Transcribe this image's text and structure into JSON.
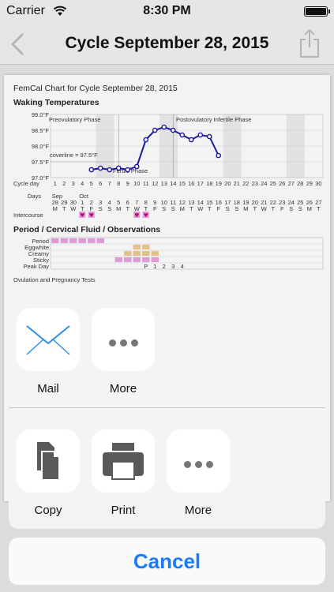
{
  "status_bar": {
    "carrier": "Carrier",
    "time": "8:30 PM"
  },
  "nav": {
    "title": "Cycle September 28, 2015"
  },
  "chart_document": {
    "heading": "FemCal Chart for Cycle September 28, 2015",
    "temp_section_title": "Waking Temperatures",
    "temp_axis_labels": [
      "99.0°F",
      "98.5°F",
      "98.0°F",
      "97.5°F",
      "97.0°F"
    ],
    "preovulatory_label": "Preovulatory Phase",
    "postovulatory_label": "Postovulatory Infertile Phase",
    "fertile_label": "Fertile Phase",
    "coverline_label": "coverline = 97.5°F",
    "cycle_day_label": "Cycle day",
    "cycle_days": [
      "1",
      "2",
      "3",
      "4",
      "5",
      "6",
      "7",
      "8",
      "9",
      "10",
      "11",
      "12",
      "13",
      "14",
      "15",
      "16",
      "17",
      "18",
      "19",
      "20",
      "21",
      "22",
      "23",
      "24",
      "25",
      "26",
      "27",
      "28",
      "29",
      "30"
    ],
    "days_label": "Days",
    "month_labels": [
      "Sep",
      "Oct"
    ],
    "dates": [
      "28",
      "29",
      "30",
      "1",
      "2",
      "3",
      "4",
      "5",
      "6",
      "7",
      "8",
      "9",
      "10",
      "11",
      "12",
      "13",
      "14",
      "15",
      "16",
      "17",
      "18",
      "19",
      "20",
      "21",
      "22",
      "23",
      "24",
      "25",
      "26",
      "27"
    ],
    "weekdays": [
      "M",
      "T",
      "W",
      "T",
      "F",
      "S",
      "S",
      "M",
      "T",
      "W",
      "T",
      "F",
      "S",
      "S",
      "M",
      "T",
      "W",
      "T",
      "F",
      "S",
      "S",
      "M",
      "T",
      "W",
      "T",
      "F",
      "S",
      "S",
      "M",
      "T"
    ],
    "intercourse_label": "Intercourse",
    "fluid_section_title": "Period / Cervical Fluid / Observations",
    "fluid_rows": [
      "Period",
      "Eggwhite",
      "Creamy",
      "Sticky",
      "Peak Day"
    ],
    "peak_day_marks": [
      "P",
      "1",
      "2",
      "3",
      "4"
    ],
    "ovulation_label": "Ovulation and Pregnancy Tests",
    "temperatures_f": [
      97.25,
      97.3,
      97.25,
      97.3,
      97.25,
      97.35,
      98.2,
      98.5,
      98.6,
      98.5,
      98.35,
      98.2,
      98.35,
      98.3,
      97.7
    ]
  },
  "share_sheet": {
    "row1": [
      {
        "label": "Mail",
        "icon": "mail-icon"
      },
      {
        "label": "More",
        "icon": "more-icon"
      }
    ],
    "row2": [
      {
        "label": "Copy",
        "icon": "copy-icon"
      },
      {
        "label": "Print",
        "icon": "print-icon"
      },
      {
        "label": "More",
        "icon": "more-icon"
      }
    ],
    "cancel_label": "Cancel"
  },
  "colors": {
    "accent": "#1c7cf4",
    "temp_line": "#1a1aa0",
    "period": "#e29ad6",
    "fluid": "#e3c28a"
  }
}
